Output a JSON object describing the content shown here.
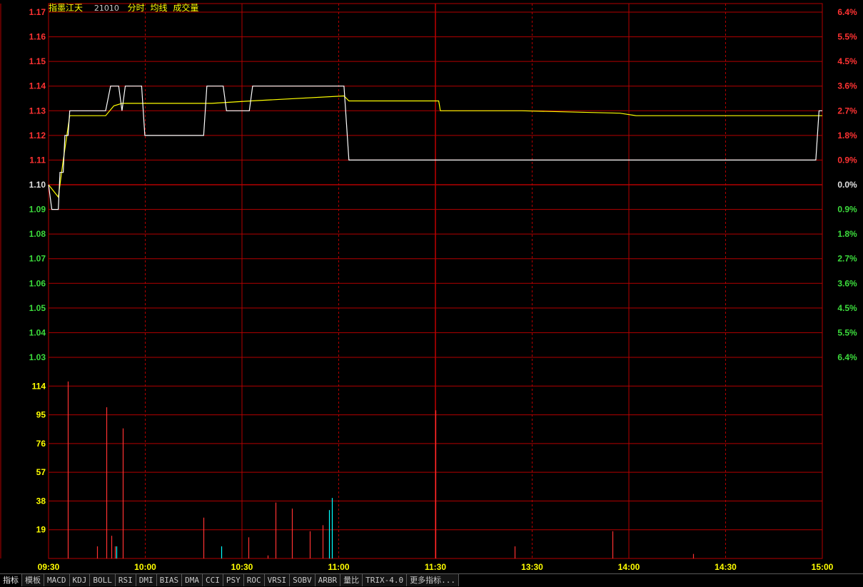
{
  "header": {
    "stock_name": "指墨江天",
    "code": "21010",
    "legend_items": [
      "分时",
      "均线",
      "成交量"
    ]
  },
  "colors": {
    "up": "#ff3232",
    "down": "#3cdc3c",
    "price_line": "#ffffff",
    "avg_line": "#ffff00",
    "grid": "#b40000",
    "volume_up": "#ff3232",
    "volume_down": "#00ffff",
    "time_label": "#ffff00"
  },
  "tabs": [
    "指标",
    "模板",
    "MACD",
    "KDJ",
    "BOLL",
    "RSI",
    "DMI",
    "BIAS",
    "DMA",
    "CCI",
    "PSY",
    "ROC",
    "VRSI",
    "SOBV",
    "ARBR",
    "量比",
    "TRIX-4.0",
    "更多指标..."
  ],
  "chart_data": {
    "type": "line",
    "prev_close": 1.1,
    "price_axis_labels": [
      "1.17",
      "1.16",
      "1.15",
      "1.14",
      "1.13",
      "1.12",
      "1.11",
      "1.10",
      "1.09",
      "1.08",
      "1.07",
      "1.06",
      "1.05",
      "1.04",
      "1.03"
    ],
    "percent_axis_labels": [
      "6.4%",
      "5.5%",
      "4.5%",
      "3.6%",
      "2.7%",
      "1.8%",
      "0.9%",
      "0.0%",
      "0.9%",
      "1.8%",
      "2.7%",
      "3.6%",
      "4.5%",
      "5.5%",
      "6.4%"
    ],
    "volume_axis_labels": [
      "114",
      "95",
      "76",
      "57",
      "38",
      "19"
    ],
    "volume_axis_values": [
      114,
      95,
      76,
      57,
      38,
      19
    ],
    "ylim_price": [
      1.03,
      1.17
    ],
    "ylim_volume": [
      0,
      133
    ],
    "time_labels": [
      "09:30",
      "10:00",
      "10:30",
      "11:00",
      "11:30",
      "13:30",
      "14:00",
      "14:30",
      "15:00"
    ],
    "price_series": [
      [
        0,
        1.1
      ],
      [
        2,
        1.09
      ],
      [
        6,
        1.09
      ],
      [
        7,
        1.105
      ],
      [
        9,
        1.105
      ],
      [
        10,
        1.12
      ],
      [
        12,
        1.12
      ],
      [
        13,
        1.13
      ],
      [
        35,
        1.13
      ],
      [
        38,
        1.14
      ],
      [
        43,
        1.14
      ],
      [
        45,
        1.13
      ],
      [
        47,
        1.14
      ],
      [
        57,
        1.14
      ],
      [
        59,
        1.12
      ],
      [
        95,
        1.12
      ],
      [
        97,
        1.14
      ],
      [
        107,
        1.14
      ],
      [
        109,
        1.13
      ],
      [
        123,
        1.13
      ],
      [
        125,
        1.14
      ],
      [
        181,
        1.14
      ],
      [
        184,
        1.11
      ],
      [
        239,
        1.11
      ],
      [
        241,
        1.11
      ],
      [
        470,
        1.11
      ],
      [
        472,
        1.13
      ],
      [
        474,
        1.13
      ]
    ],
    "avg_series": [
      [
        0,
        1.1
      ],
      [
        6,
        1.095
      ],
      [
        9,
        1.11
      ],
      [
        13,
        1.128
      ],
      [
        35,
        1.128
      ],
      [
        40,
        1.132
      ],
      [
        45,
        1.133
      ],
      [
        60,
        1.133
      ],
      [
        100,
        1.133
      ],
      [
        124,
        1.134
      ],
      [
        181,
        1.136
      ],
      [
        184,
        1.134
      ],
      [
        239,
        1.134
      ],
      [
        240,
        1.13
      ],
      [
        290,
        1.13
      ],
      [
        350,
        1.129
      ],
      [
        360,
        1.128
      ],
      [
        474,
        1.128
      ]
    ],
    "volume_bars": [
      {
        "t": 12,
        "v": 117,
        "dir": "up"
      },
      {
        "t": 30,
        "v": 8,
        "dir": "up"
      },
      {
        "t": 36,
        "v": 100,
        "dir": "up"
      },
      {
        "t": 39,
        "v": 15,
        "dir": "up"
      },
      {
        "t": 41,
        "v": 8,
        "dir": "up"
      },
      {
        "t": 42,
        "v": 8,
        "dir": "down"
      },
      {
        "t": 46,
        "v": 86,
        "dir": "up"
      },
      {
        "t": 96,
        "v": 27,
        "dir": "up"
      },
      {
        "t": 107,
        "v": 8,
        "dir": "down"
      },
      {
        "t": 124,
        "v": 14,
        "dir": "up"
      },
      {
        "t": 136,
        "v": 2,
        "dir": "up"
      },
      {
        "t": 141,
        "v": 37,
        "dir": "up"
      },
      {
        "t": 151,
        "v": 33,
        "dir": "up"
      },
      {
        "t": 162,
        "v": 18,
        "dir": "up"
      },
      {
        "t": 170,
        "v": 22,
        "dir": "up"
      },
      {
        "t": 174,
        "v": 32,
        "dir": "down"
      },
      {
        "t": 176,
        "v": 40,
        "dir": "down"
      },
      {
        "t": 240,
        "v": 98,
        "dir": "up"
      },
      {
        "t": 289,
        "v": 8,
        "dir": "up"
      },
      {
        "t": 350,
        "v": 18,
        "dir": "up"
      },
      {
        "t": 400,
        "v": 3,
        "dir": "up"
      }
    ]
  }
}
